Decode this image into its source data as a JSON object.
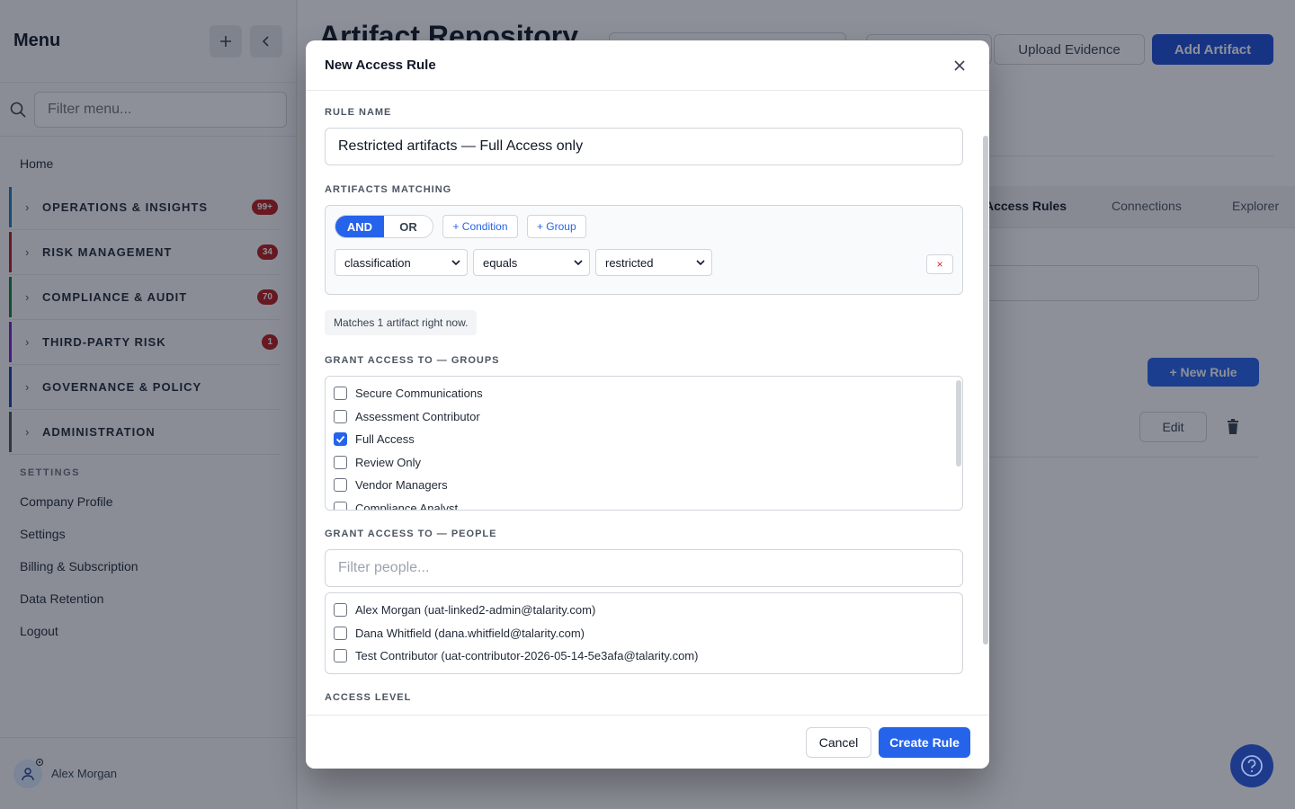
{
  "sidebar": {
    "title": "Menu",
    "add_icon": "plus-icon",
    "collapse_icon": "chevron-left-icon",
    "search_placeholder": "Filter menu...",
    "home": "Home",
    "sections": [
      {
        "label": "OPERATIONS & INSIGHTS",
        "badge": "99+",
        "color": "#2b7bb9"
      },
      {
        "label": "RISK MANAGEMENT",
        "badge": "34",
        "color": "#b91c1c"
      },
      {
        "label": "COMPLIANCE & AUDIT",
        "badge": "70",
        "color": "#15803d"
      },
      {
        "label": "THIRD-PARTY RISK",
        "badge": "1",
        "color": "#7e22ce"
      },
      {
        "label": "GOVERNANCE & POLICY",
        "badge": "",
        "color": "#1e40af"
      },
      {
        "label": "ADMINISTRATION",
        "badge": "",
        "color": "#4b5563"
      }
    ],
    "settings_header": "SETTINGS",
    "settings_links": [
      "Company Profile",
      "Settings",
      "Billing & Subscription",
      "Data Retention",
      "Logout"
    ],
    "user_name": "Alex Morgan"
  },
  "main": {
    "page_title": "Artifact Repository",
    "upload_button": "Upload Evidence",
    "add_button": "Add Artifact",
    "tabs": [
      "Access Rules",
      "Connections",
      "Explorer"
    ],
    "new_rule_button": "+ New Rule",
    "edit_button": "Edit"
  },
  "modal": {
    "title": "New Access Rule",
    "rule_name_label": "RULE NAME",
    "rule_name_value": "Restricted artifacts — Full Access only",
    "matching_label": "ARTIFACTS MATCHING",
    "and_label": "AND",
    "or_label": "OR",
    "add_condition": "+ Condition",
    "add_group": "+ Group",
    "condition": {
      "field": "classification",
      "operator": "equals",
      "value": "restricted"
    },
    "remove_label": "×",
    "match_note": "Matches 1 artifact right now.",
    "groups_label": "GRANT ACCESS TO — GROUPS",
    "groups": [
      {
        "label": "Secure Communications",
        "checked": false
      },
      {
        "label": "Assessment Contributor",
        "checked": false
      },
      {
        "label": "Full Access",
        "checked": true
      },
      {
        "label": "Review Only",
        "checked": false
      },
      {
        "label": "Vendor Managers",
        "checked": false
      },
      {
        "label": "Compliance Analyst",
        "checked": false
      }
    ],
    "people_label": "GRANT ACCESS TO — PEOPLE",
    "people_placeholder": "Filter people...",
    "people": [
      {
        "label": "Alex Morgan (uat-linked2-admin@talarity.com)",
        "checked": false
      },
      {
        "label": "Dana Whitfield (dana.whitfield@talarity.com)",
        "checked": false
      },
      {
        "label": "Test Contributor (uat-contributor-2026-05-14-5e3afa@talarity.com)",
        "checked": false
      }
    ],
    "access_level_label": "ACCESS LEVEL",
    "cancel_button": "Cancel",
    "create_button": "Create Rule"
  },
  "colors": {
    "primary": "#2563eb",
    "badge": "#b91c1c"
  }
}
